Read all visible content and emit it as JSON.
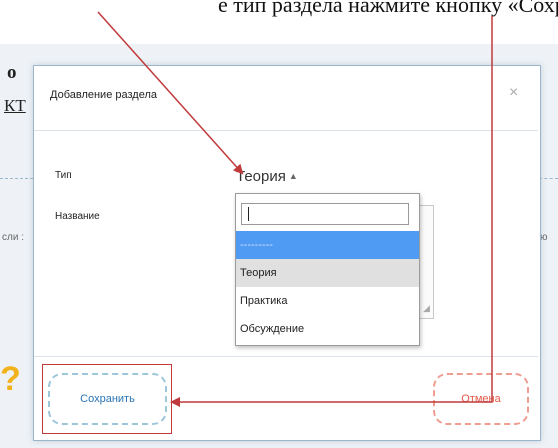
{
  "instruction": {
    "text": "е тип раздела нажмите кнопку «Сохранить»."
  },
  "background": {
    "fragment_o": "о",
    "fragment_kt": "КТ",
    "fragment_li": "сли :",
    "fragment_r": "ю"
  },
  "modal": {
    "title": "Добавление раздела",
    "close": "×",
    "type_label": "Тип",
    "type_value": "Теория",
    "name_label": "Название"
  },
  "dropdown": {
    "search_value": "",
    "options": [
      {
        "label": "---------",
        "state": "highlighted"
      },
      {
        "label": "Теория",
        "state": "selected"
      },
      {
        "label": "Практика",
        "state": "normal"
      },
      {
        "label": "Обсуждение",
        "state": "normal"
      }
    ]
  },
  "footer": {
    "save_label": "Сохранить",
    "cancel_label": "Отмена"
  },
  "colors": {
    "modal_border": "#9bb5cc",
    "dropdown_highlight": "#4f9af3",
    "dropdown_selected": "#e0e0e0",
    "save_border": "#9cc6d9",
    "save_text": "#2a74b8",
    "cancel_border": "#ef9d90",
    "cancel_text": "#e05a48",
    "annotation_red": "#c0393b"
  }
}
